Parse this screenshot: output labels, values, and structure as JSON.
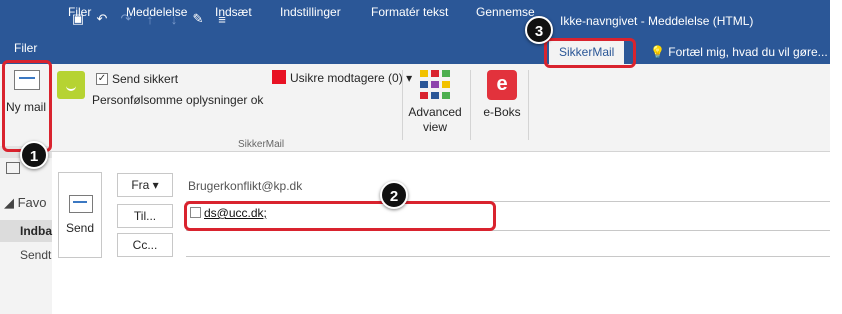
{
  "main_window": {
    "files_tab": "Filer",
    "new_mail_label": "Ny mail",
    "favorites_label": "Favo",
    "inbox_label": "Indba",
    "sent_label": "Sendt"
  },
  "title_bar": {
    "title": "Ikke-navngivet - Meddelelse (HTML)"
  },
  "ribbon": {
    "tabs": [
      {
        "label": "Filer"
      },
      {
        "label": "Meddelelse"
      },
      {
        "label": "Indsæt"
      },
      {
        "label": "Indstillinger"
      },
      {
        "label": "Formatér tekst"
      },
      {
        "label": "Gennemse"
      },
      {
        "label": "SikkerMail"
      }
    ],
    "active_tab": "SikkerMail",
    "tell_me": "Fortæl mig, hvad du vil gøre...",
    "send_secure_label": "Send sikkert",
    "send_secure_checked": true,
    "personal_data_label": "Personfølsomme oplysninger ok",
    "unsafe_recipients_label": "Usikre modtagere (0)",
    "group_label": "SikkerMail",
    "advanced_view_label": "Advanced view",
    "eboks_label": "e-Boks",
    "eboks_icon_letter": "e"
  },
  "compose": {
    "send_label": "Send",
    "from_button": "Fra",
    "from_value": "Brugerkonflikt@kp.dk",
    "to_button": "Til...",
    "to_value": "ds@ucc.dk;",
    "cc_button": "Cc..."
  },
  "callouts": [
    "1",
    "2",
    "3"
  ],
  "colors": {
    "title_bar": "#2b5797",
    "highlight": "#d9232e",
    "unsafe_square": "#e81123",
    "smiley": "#b6d332",
    "eboks": "#e2323c"
  }
}
